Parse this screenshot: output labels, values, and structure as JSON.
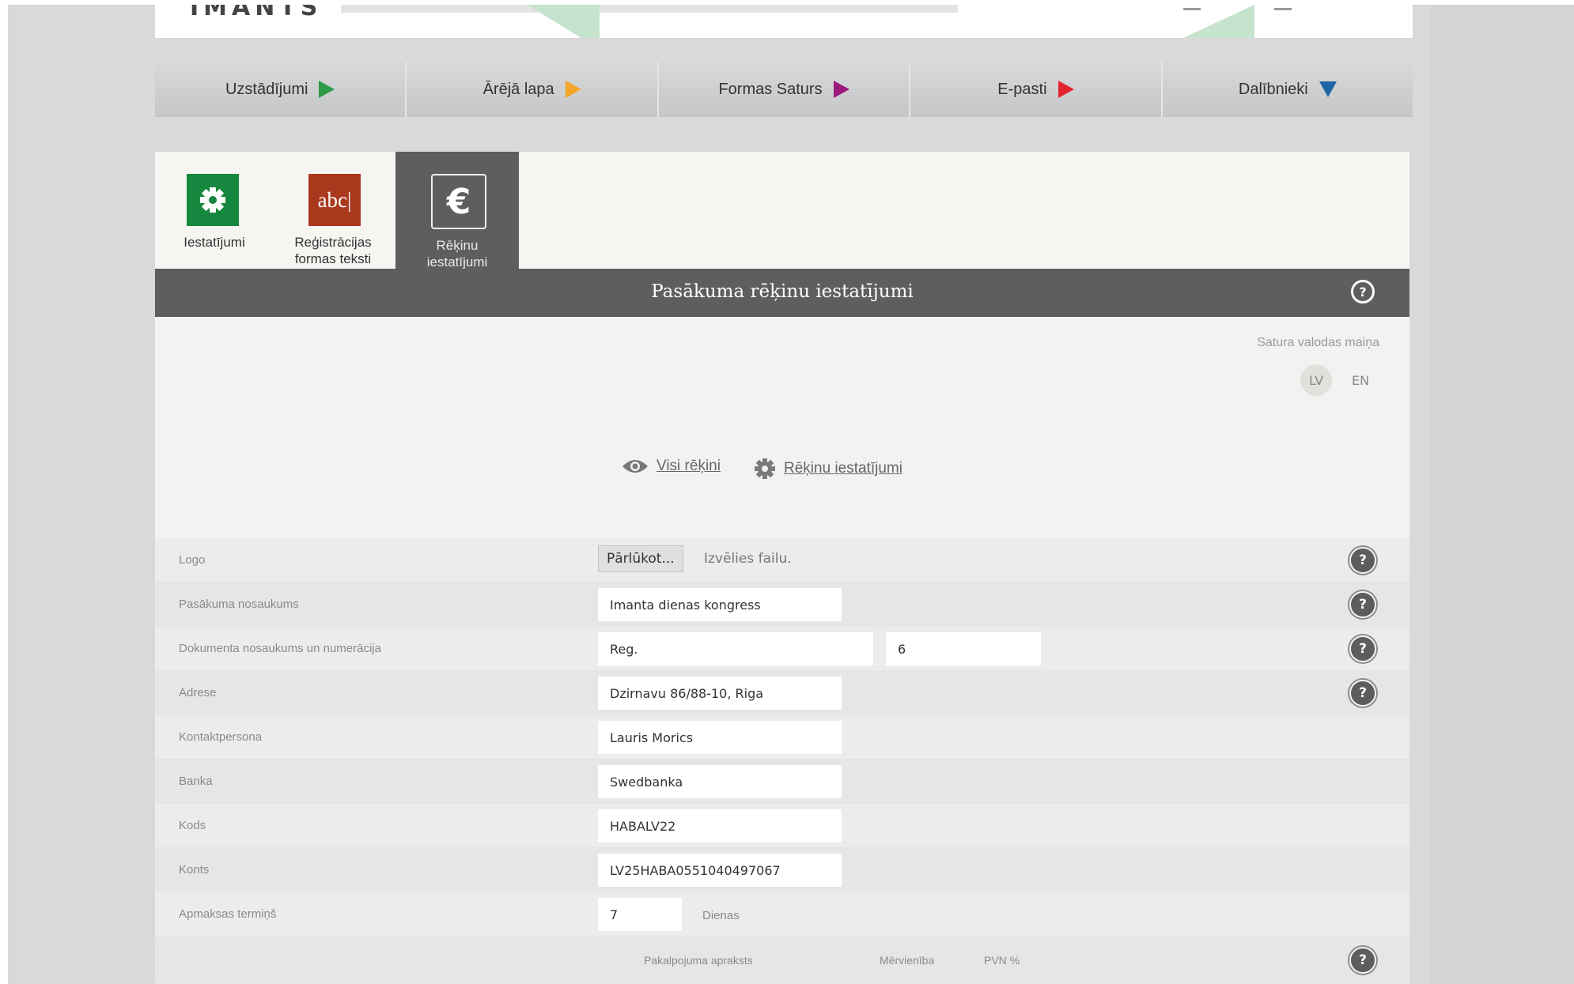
{
  "header": {
    "brand": "IMANTS"
  },
  "nav": [
    {
      "label": "Uzstādījumi",
      "arrow_color": "#2e9a47"
    },
    {
      "label": "Ārējā lapa",
      "arrow_color": "#f4a62a"
    },
    {
      "label": "Formas Saturs",
      "arrow_color": "#9d1a7f"
    },
    {
      "label": "E-pasti",
      "arrow_color": "#e3262e"
    },
    {
      "label": "Dalībnieki",
      "arrow_color": "#1c66a8"
    }
  ],
  "modules": [
    {
      "label_line1": "Iestatījumi",
      "label_line2": ""
    },
    {
      "label_line1": "Reģistrācijas",
      "label_line2": "formas teksti",
      "tile_text": "abc|"
    },
    {
      "label_line1": "Rēķinu",
      "label_line2": "iestatījumi",
      "tile_text": "€"
    }
  ],
  "title_bar": {
    "title": "Pasākuma rēķinu iestatījumi",
    "help": "?"
  },
  "language": {
    "caption": "Satura valodas maiņa",
    "options": [
      "LV",
      "EN"
    ],
    "selected": "LV"
  },
  "actions": {
    "all_invoices": "Visi rēķini",
    "invoice_settings": "Rēķinu iestatījumi"
  },
  "form": {
    "logo": {
      "label": "Logo",
      "browse": "Pārlūkot...",
      "file_placeholder": "Izvēlies failu."
    },
    "event_name": {
      "label": "Pasākuma nosaukums",
      "value": "Imanta dienas kongress"
    },
    "doc_name": {
      "label": "Dokumenta nosaukums un numerācija",
      "prefix": "Reg.",
      "number": "6"
    },
    "address": {
      "label": "Adrese",
      "value": "Dzirnavu 86/88-10, Riga"
    },
    "contact": {
      "label": "Kontaktpersona",
      "value": "Lauris Morics"
    },
    "bank": {
      "label": "Banka",
      "value": "Swedbanka"
    },
    "code": {
      "label": "Kods",
      "value": "HABALV22"
    },
    "account": {
      "label": "Konts",
      "value": "LV25HABA0551040497067"
    },
    "payment_term": {
      "label": "Apmaksas termiņš",
      "value": "7",
      "unit": "Dienas"
    },
    "services": {
      "col_description": "Pakalpojuma apraksts",
      "col_unit": "Mērvienība",
      "col_vat": "PVN %"
    }
  },
  "help_glyph": "?"
}
